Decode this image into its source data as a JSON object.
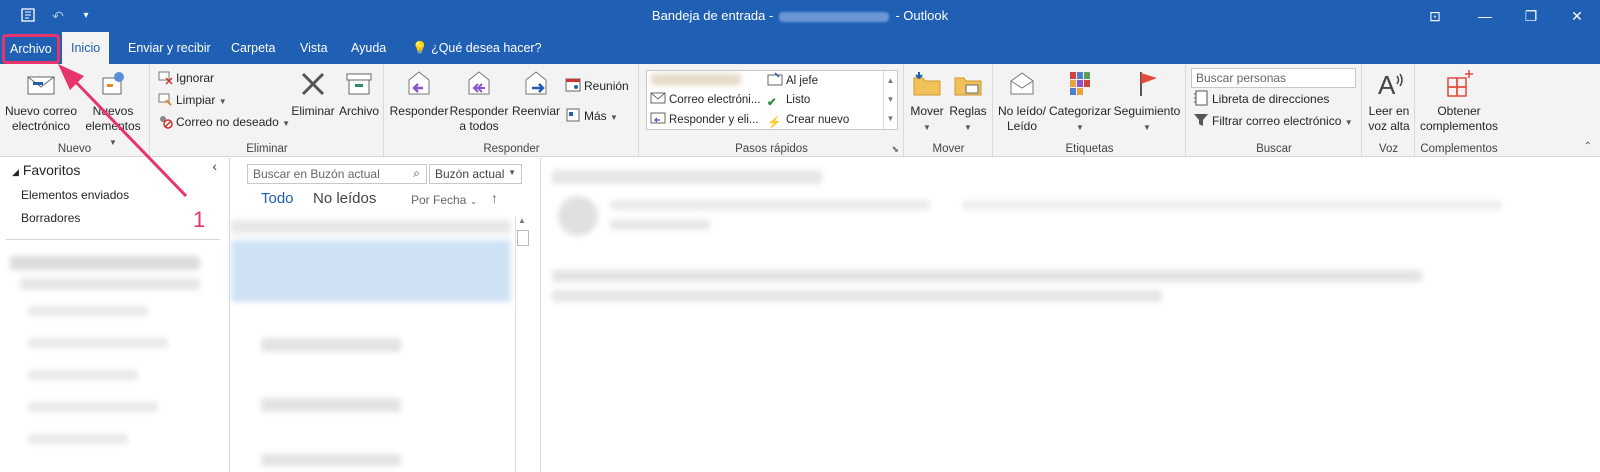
{
  "window": {
    "title_left": "Bandeja de entrada -",
    "title_right": "- Outlook"
  },
  "tabs": [
    {
      "label": "Archivo"
    },
    {
      "label": "Inicio"
    },
    {
      "label": "Enviar y recibir"
    },
    {
      "label": "Carpeta"
    },
    {
      "label": "Vista"
    },
    {
      "label": "Ayuda"
    },
    {
      "label": "¿Qué desea hacer?"
    }
  ],
  "ribbon": {
    "nuevo": {
      "new_email": "Nuevo correo electrónico",
      "new_items": "Nuevos elementos",
      "label": "Nuevo"
    },
    "eliminar": {
      "ignore": "Ignorar",
      "clean": "Limpiar",
      "junk": "Correo no deseado",
      "delete": "Eliminar",
      "archive": "Archivo",
      "label": "Eliminar"
    },
    "responder": {
      "reply": "Responder",
      "reply_all": "Responder a todos",
      "forward": "Reenviar",
      "meeting": "Reunión",
      "more": "Más",
      "label": "Responder"
    },
    "pasos": {
      "items": [
        "Correo electróni...",
        "Responder y eli...",
        "Al jefe",
        "Listo",
        "Crear nuevo"
      ],
      "label": "Pasos rápidos"
    },
    "mover": {
      "move": "Mover",
      "rules": "Reglas",
      "label": "Mover"
    },
    "etiquetas": {
      "unread": "No leído/ Leído",
      "categorize": "Categorizar",
      "followup": "Seguimiento",
      "label": "Etiquetas"
    },
    "buscar": {
      "search_placeholder": "Buscar personas",
      "address_book": "Libreta de direcciones",
      "filter": "Filtrar correo electrónico",
      "label": "Buscar"
    },
    "voz": {
      "read_aloud": "Leer en voz alta",
      "label": "Voz"
    },
    "complementos": {
      "get_addins": "Obtener complementos",
      "label": "Complementos"
    }
  },
  "folders": {
    "favorites": "Favoritos",
    "items": [
      "Elementos enviados",
      "Borradores"
    ]
  },
  "messagelist": {
    "search_placeholder": "Buscar en Buzón actual",
    "scope": "Buzón actual",
    "filter_all": "Todo",
    "filter_unread": "No leídos",
    "sort": "Por Fecha"
  },
  "annotation": {
    "number": "1"
  },
  "colors": {
    "brand": "#1f5fb4",
    "highlight": "#e8336b"
  }
}
